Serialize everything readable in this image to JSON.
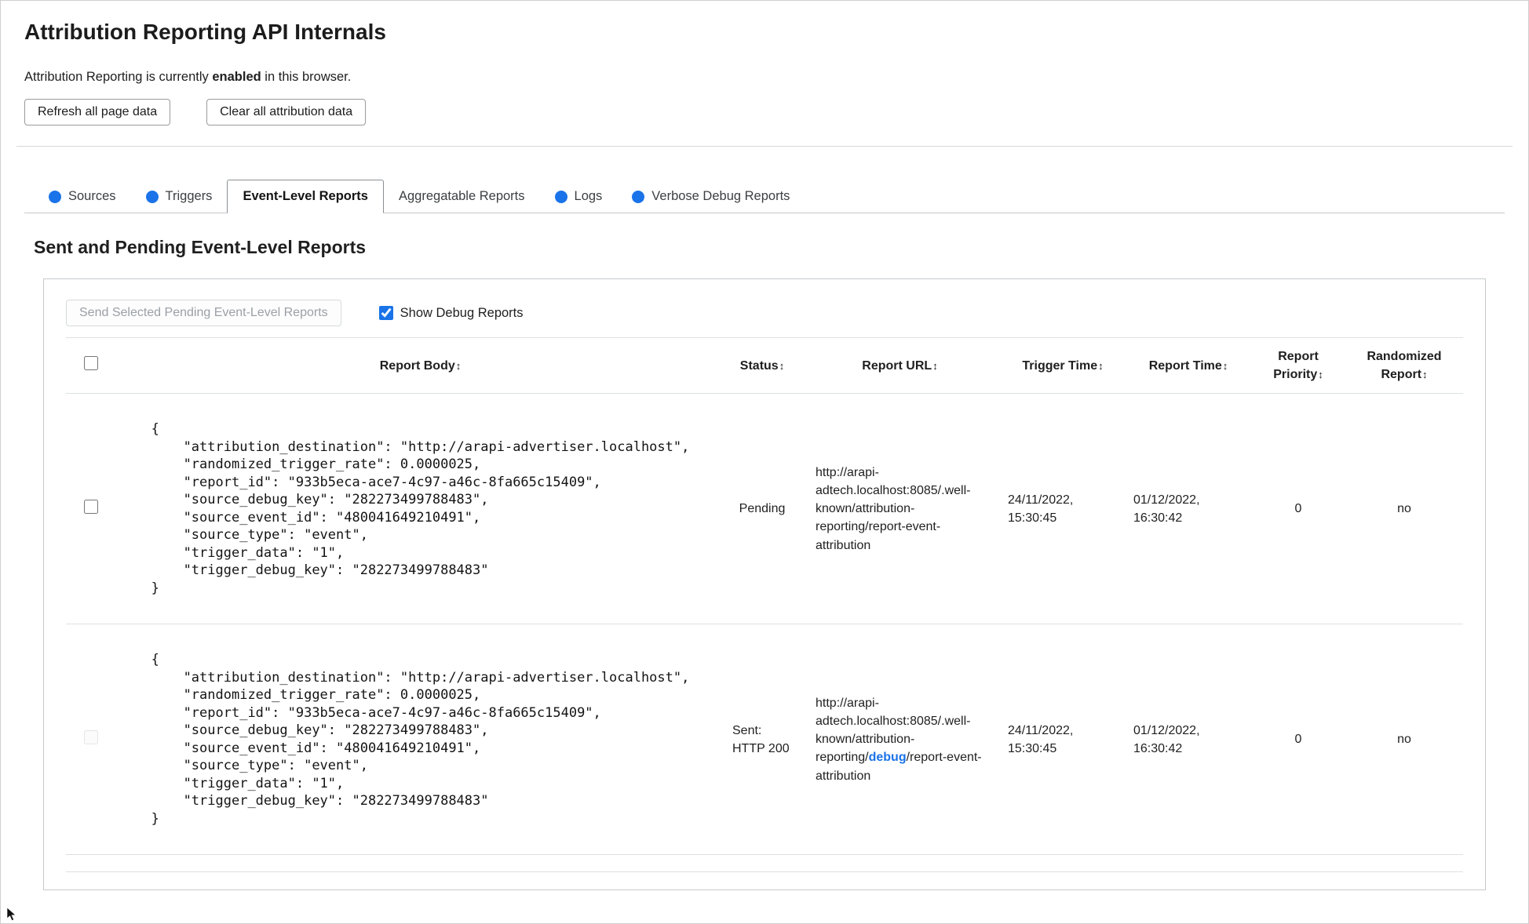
{
  "header": {
    "title": "Attribution Reporting API Internals",
    "status_prefix": "Attribution Reporting is currently ",
    "status_bold": "enabled",
    "status_suffix": " in this browser.",
    "refresh_button": "Refresh all page data",
    "clear_button": "Clear all attribution data"
  },
  "tabs": {
    "items": [
      {
        "label": "Sources"
      },
      {
        "label": "Triggers"
      },
      {
        "label": "Event-Level Reports"
      },
      {
        "label": "Aggregatable Reports"
      },
      {
        "label": "Logs"
      },
      {
        "label": "Verbose Debug Reports"
      }
    ]
  },
  "section": {
    "heading": "Sent and Pending Event-Level Reports",
    "send_button_label": "Send Selected Pending Event-Level Reports",
    "show_debug_label": "Show Debug Reports",
    "show_debug_checked": true
  },
  "table": {
    "sort_icon": "↕",
    "columns": [
      "Report Body",
      "Status",
      "Report URL",
      "Trigger Time",
      "Report Time",
      "Report Priority",
      "Randomized Report"
    ],
    "rows": [
      {
        "selected": false,
        "checkbox_disabled": false,
        "report_body": "{\n    \"attribution_destination\": \"http://arapi-advertiser.localhost\",\n    \"randomized_trigger_rate\": 0.0000025,\n    \"report_id\": \"933b5eca-ace7-4c97-a46c-8fa665c15409\",\n    \"source_debug_key\": \"282273499788483\",\n    \"source_event_id\": \"480041649210491\",\n    \"source_type\": \"event\",\n    \"trigger_data\": \"1\",\n    \"trigger_debug_key\": \"282273499788483\"\n}",
        "status": "Pending",
        "url_before": "http://arapi-adtech.localhost:8085/.well-known/attribution-reporting/",
        "url_link": "",
        "url_after": "report-event-attribution",
        "trigger_time": "24/11/2022, 15:30:45",
        "report_time": "01/12/2022, 16:30:42",
        "report_priority": "0",
        "randomized_report": "no"
      },
      {
        "selected": false,
        "checkbox_disabled": true,
        "report_body": "{\n    \"attribution_destination\": \"http://arapi-advertiser.localhost\",\n    \"randomized_trigger_rate\": 0.0000025,\n    \"report_id\": \"933b5eca-ace7-4c97-a46c-8fa665c15409\",\n    \"source_debug_key\": \"282273499788483\",\n    \"source_event_id\": \"480041649210491\",\n    \"source_type\": \"event\",\n    \"trigger_data\": \"1\",\n    \"trigger_debug_key\": \"282273499788483\"\n}",
        "status": "Sent: HTTP 200",
        "url_before": "http://arapi-adtech.localhost:8085/.well-known/attribution-reporting/",
        "url_link": "debug",
        "url_after": "/report-event-attribution",
        "trigger_time": "24/11/2022, 15:30:45",
        "report_time": "01/12/2022, 16:30:42",
        "report_priority": "0",
        "randomized_report": "no"
      }
    ]
  }
}
